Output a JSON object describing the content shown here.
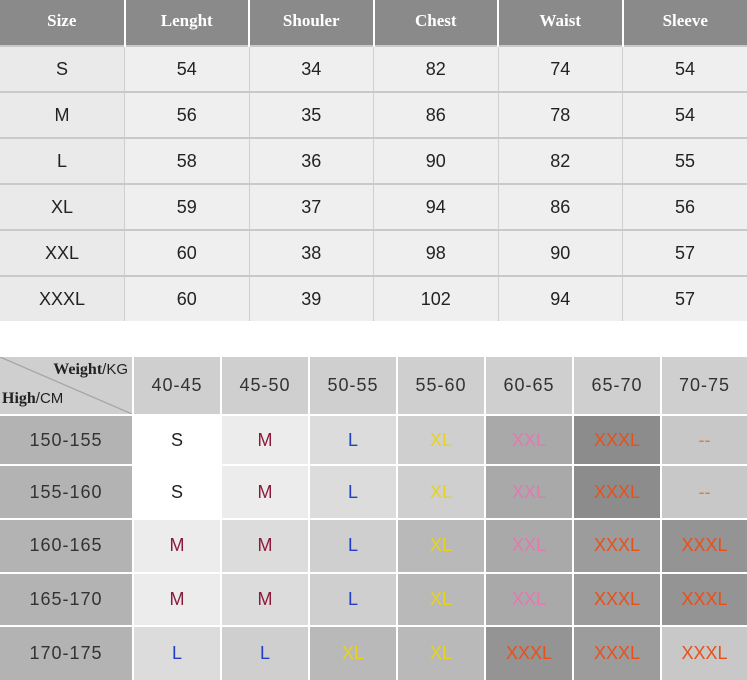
{
  "size_table": {
    "headers": [
      "Size",
      "Lenght",
      "Shouler",
      "Chest",
      "Waist",
      "Sleeve"
    ],
    "rows": [
      [
        "S",
        "54",
        "34",
        "82",
        "74",
        "54"
      ],
      [
        "M",
        "56",
        "35",
        "86",
        "78",
        "54"
      ],
      [
        "L",
        "58",
        "36",
        "90",
        "82",
        "55"
      ],
      [
        "XL",
        "59",
        "37",
        "94",
        "86",
        "56"
      ],
      [
        "XXL",
        "60",
        "38",
        "98",
        "90",
        "57"
      ],
      [
        "XXXL",
        "60",
        "39",
        "102",
        "94",
        "57"
      ]
    ]
  },
  "fit_table": {
    "corner": {
      "weight_label": "Weight",
      "weight_unit": "/KG",
      "height_label": "High",
      "height_unit": "/CM"
    },
    "weight_headers": [
      "40-45",
      "45-50",
      "50-55",
      "55-60",
      "60-65",
      "65-70",
      "70-75"
    ],
    "height_headers": [
      "150-155",
      "155-160",
      "160-165",
      "165-170",
      "170-175"
    ],
    "cells": [
      [
        "S",
        "M",
        "L",
        "XL",
        "XXL",
        "XXXL",
        "--"
      ],
      [
        "S",
        "M",
        "L",
        "XL",
        "XXL",
        "XXXL",
        "--"
      ],
      [
        "M",
        "M",
        "L",
        "XL",
        "XXL",
        "XXXL",
        "XXXL"
      ],
      [
        "M",
        "M",
        "L",
        "XL",
        "XXL",
        "XXXL",
        "XXXL"
      ],
      [
        "L",
        "L",
        "XL",
        "XL",
        "XXXL",
        "XXXL",
        "XXXL"
      ]
    ],
    "size_colors": {
      "S": "#222222",
      "M": "#8b1a3a",
      "L": "#1f3fc4",
      "XL": "#e8d21a",
      "XXL": "#e07ab0",
      "XXXL": "#e8501a",
      "--": "#e8801a"
    },
    "cells_bg": [
      [
        "#ffffff",
        "#ececec",
        "#dcdcdc",
        "#cfcfcf",
        "#a9a9a9",
        "#8c8c8c",
        "#c8c8c8"
      ],
      [
        "#ffffff",
        "#ececec",
        "#dcdcdc",
        "#cfcfcf",
        "#a9a9a9",
        "#8c8c8c",
        "#c8c8c8"
      ],
      [
        "#ececec",
        "#dcdcdc",
        "#cfcfcf",
        "#b9b9b9",
        "#a9a9a9",
        "#9c9c9c",
        "#949494"
      ],
      [
        "#ececec",
        "#dcdcdc",
        "#cfcfcf",
        "#b9b9b9",
        "#a9a9a9",
        "#9c9c9c",
        "#949494"
      ],
      [
        "#dcdcdc",
        "#cfcfcf",
        "#b9b9b9",
        "#b9b9b9",
        "#949494",
        "#9c9c9c",
        "#c8c8c8"
      ]
    ],
    "header_bg": "#cfcfcf",
    "height_header_bg": "#b3b3b3"
  }
}
